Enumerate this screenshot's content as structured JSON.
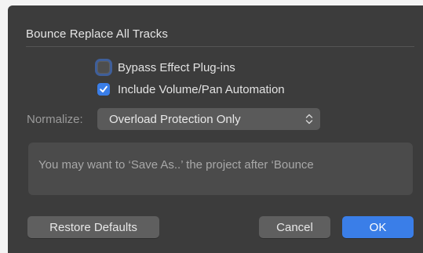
{
  "dialog": {
    "title": "Bounce Replace All Tracks",
    "options": {
      "bypass_effects": {
        "label": "Bypass Effect Plug-ins",
        "checked": false
      },
      "include_automation": {
        "label": "Include Volume/Pan Automation",
        "checked": true
      }
    },
    "normalize": {
      "label": "Normalize:",
      "selected": "Overload Protection Only"
    },
    "info_text": "You may want to ‘Save As..’ the project after ‘Bounce",
    "buttons": {
      "restore_defaults": "Restore Defaults",
      "cancel": "Cancel",
      "ok": "OK"
    }
  },
  "colors": {
    "dialog_bg": "#3c3c3c",
    "accent": "#3a7ee8",
    "focus_ring": "#3f5f9a"
  },
  "icons": {
    "checkmark": "checkmark-icon",
    "select_arrows": "up-down-chevron-icon"
  }
}
